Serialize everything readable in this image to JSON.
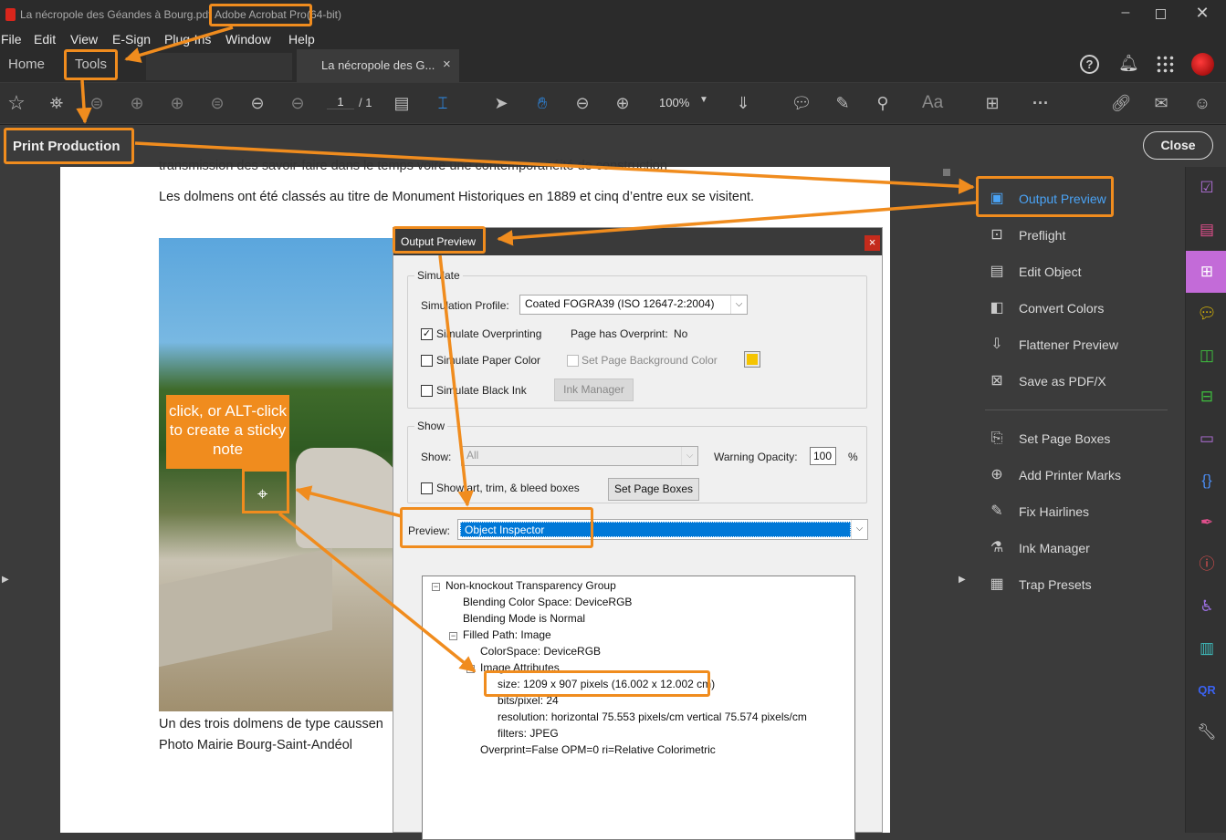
{
  "window": {
    "doc_title": "La nécropole des Géandes à Bourg.pdf",
    "app_name": "Adobe Acrobat Pro",
    "bitness": "(64-bit)"
  },
  "menu": [
    "File",
    "Edit",
    "View",
    "E-Sign",
    "Plug-Ins",
    "Window",
    "Help"
  ],
  "tabs": {
    "home": "Home",
    "tools": "Tools",
    "doc_tab": "La nécropole des G...",
    "close_glyph": "×"
  },
  "toolbar": {
    "page_current": "1",
    "page_total": "/ 1",
    "zoom": "100%",
    "text_tool": "Aa"
  },
  "print_production": {
    "title": "Print Production",
    "close": "Close"
  },
  "page_text": {
    "top_line": "transmission des savoir-faire dans le temps voire une contemporanéité de construction",
    "paragraph": "Les dolmens ont été classés au titre de Monument Historiques en 1889 et cinq d’entre eux se visitent.",
    "caption1": "Un des trois dolmens de type caussen",
    "caption2": "Photo Mairie Bourg-Saint-Andéol"
  },
  "callout": "click, or ALT-click to create a sticky note",
  "right_panel": {
    "items": [
      {
        "label": "Output Preview",
        "icon": "output-preview-icon"
      },
      {
        "label": "Preflight",
        "icon": "preflight-icon"
      },
      {
        "label": "Edit Object",
        "icon": "edit-object-icon"
      },
      {
        "label": "Convert Colors",
        "icon": "convert-colors-icon"
      },
      {
        "label": "Flattener Preview",
        "icon": "flattener-icon"
      },
      {
        "label": "Save as PDF/X",
        "icon": "save-pdfx-icon"
      },
      {
        "label": "Set Page Boxes",
        "icon": "page-boxes-icon"
      },
      {
        "label": "Add Printer Marks",
        "icon": "printer-marks-icon"
      },
      {
        "label": "Fix Hairlines",
        "icon": "hairlines-icon"
      },
      {
        "label": "Ink Manager",
        "icon": "ink-icon"
      },
      {
        "label": "Trap Presets",
        "icon": "trap-icon"
      }
    ]
  },
  "dialog": {
    "title": "Output Preview",
    "close": "×",
    "simulate": {
      "group_label": "Simulate",
      "profile_label": "Simulation Profile:",
      "profile_value": "Coated FOGRA39 (ISO 12647-2:2004)",
      "overprinting": "Simulate Overprinting",
      "overprinting_checked": true,
      "page_overprint_label": "Page has Overprint:",
      "page_overprint_value": "No",
      "paper_color": "Simulate Paper Color",
      "bg_color": "Set Page Background Color",
      "bg_swatch": "#f5c400",
      "black_ink": "Simulate Black Ink",
      "ink_manager": "Ink Manager"
    },
    "show": {
      "group_label": "Show",
      "show_label": "Show:",
      "show_value": "All",
      "opacity_label": "Warning Opacity:",
      "opacity_value": "100",
      "opacity_unit": "%",
      "boxes_label": "Show art, trim, & bleed boxes",
      "set_boxes": "Set Page Boxes"
    },
    "preview_label": "Preview:",
    "preview_value": "Object Inspector",
    "tree": [
      "Non-knockout Transparency Group",
      "Blending Color Space: DeviceRGB",
      "Blending Mode is Normal",
      "Filled Path: Image",
      "ColorSpace: DeviceRGB",
      "Image Attributes",
      "size: 1209 x 907 pixels (16.002 x 12.002 cm)",
      "bits/pixel: 24",
      "resolution: horizontal 75.553 pixels/cm vertical 75.574 pixels/cm",
      "filters: JPEG",
      "Overprint=False OPM=0 ri=Relative Colorimetric"
    ]
  },
  "colors": {
    "accent_orange": "#f08c1e",
    "link_blue": "#2d8ceb",
    "selected_blue": "#0078d7",
    "tool_pink": "#c36bd8"
  }
}
